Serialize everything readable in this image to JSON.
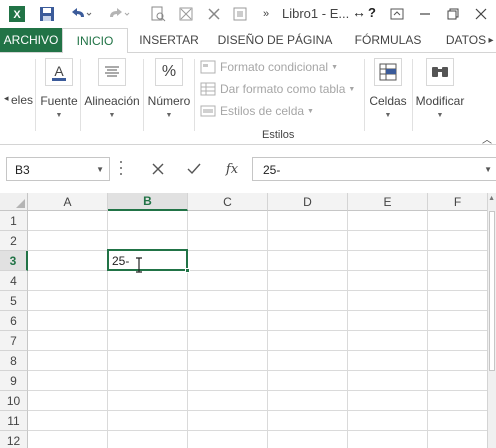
{
  "window": {
    "title": "Libro1 - E...",
    "help_label": "?",
    "resize_glyph": "↔"
  },
  "quick_access": {
    "icons": [
      "excel-logo-icon",
      "save-icon",
      "undo-icon",
      "redo-icon",
      "print-preview-icon",
      "format-painter-icon",
      "clear-icon",
      "paste-format-icon",
      "more-icon"
    ]
  },
  "tabs": {
    "archivo": "ARCHIVO",
    "inicio": "INICIO",
    "insertar": "INSERTAR",
    "diseno": "DISEÑO DE PÁGINA",
    "formulas": "FÓRMULAS",
    "datos": "DATOS"
  },
  "ribbon": {
    "partial_label": "eles",
    "fuente": "Fuente",
    "alineacion": "Alineación",
    "numero": "Número",
    "formato_condicional": "Formato condicional",
    "dar_formato_tabla": "Dar formato como tabla",
    "estilos_celda": "Estilos de celda",
    "estilos_group": "Estilos",
    "celdas": "Celdas",
    "modificar": "Modificar",
    "numero_glyph": "%"
  },
  "formula_bar": {
    "name_box": "B3",
    "fx_label": "fx",
    "formula": "25-"
  },
  "grid": {
    "columns": [
      "A",
      "B",
      "C",
      "D",
      "E",
      "F"
    ],
    "rows": [
      "1",
      "2",
      "3",
      "4",
      "5",
      "6",
      "7",
      "8",
      "9",
      "10",
      "11",
      "12"
    ],
    "selected_column": "B",
    "selected_row": "3",
    "active_cell_value": "25-"
  },
  "colors": {
    "accent": "#217346"
  }
}
